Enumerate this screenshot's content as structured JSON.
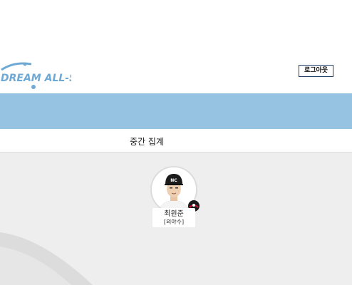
{
  "header": {
    "logo_text": "DREAM ALL-STAR",
    "logout_label": "로그아웃"
  },
  "tabs": {
    "active_label": "중간 집계"
  },
  "player": {
    "name": "최원준",
    "position": "[외야수]",
    "team_badge_icon": "team-logo-icon"
  },
  "colors": {
    "brand_blue": "#97c3e2",
    "logo_blue": "#6ea9d6",
    "content_bg": "#eeeeee"
  }
}
